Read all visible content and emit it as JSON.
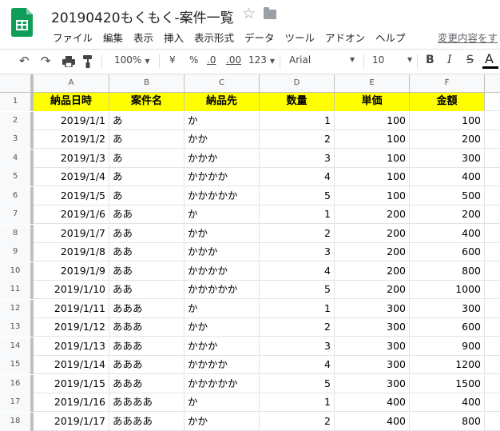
{
  "doc": {
    "title": "20190420もくもく-案件一覧",
    "star_icon": "star-outline-icon",
    "folder_icon": "folder-icon"
  },
  "menu": [
    "ファイル",
    "編集",
    "表示",
    "挿入",
    "表示形式",
    "データ",
    "ツール",
    "アドオン",
    "ヘルプ"
  ],
  "last_edit": "変更内容をす",
  "toolbar": {
    "zoom": "100%",
    "currency": "¥",
    "percent": "%",
    "dec_decrease": ".0",
    "dec_increase": ".00",
    "format": "123",
    "font": "Arial",
    "font_size": "10",
    "bold": "B",
    "italic": "I",
    "strike": "S",
    "text_color": "A"
  },
  "columns": [
    "A",
    "B",
    "C",
    "D",
    "E",
    "F"
  ],
  "header_fill": "#ffff00",
  "rows": [
    {
      "n": "1",
      "a": "納品日時",
      "b": "案件名",
      "c": "納品先",
      "d": "数量",
      "e": "単価",
      "f": "金額"
    },
    {
      "n": "2",
      "a": "2019/1/1",
      "b": "あ",
      "c": "か",
      "d": "1",
      "e": "100",
      "f": "100"
    },
    {
      "n": "3",
      "a": "2019/1/2",
      "b": "あ",
      "c": "かか",
      "d": "2",
      "e": "100",
      "f": "200"
    },
    {
      "n": "4",
      "a": "2019/1/3",
      "b": "あ",
      "c": "かかか",
      "d": "3",
      "e": "100",
      "f": "300"
    },
    {
      "n": "5",
      "a": "2019/1/4",
      "b": "あ",
      "c": "かかかか",
      "d": "4",
      "e": "100",
      "f": "400"
    },
    {
      "n": "6",
      "a": "2019/1/5",
      "b": "あ",
      "c": "かかかかか",
      "d": "5",
      "e": "100",
      "f": "500"
    },
    {
      "n": "7",
      "a": "2019/1/6",
      "b": "ああ",
      "c": "か",
      "d": "1",
      "e": "200",
      "f": "200"
    },
    {
      "n": "8",
      "a": "2019/1/7",
      "b": "ああ",
      "c": "かか",
      "d": "2",
      "e": "200",
      "f": "400"
    },
    {
      "n": "9",
      "a": "2019/1/8",
      "b": "ああ",
      "c": "かかか",
      "d": "3",
      "e": "200",
      "f": "600"
    },
    {
      "n": "10",
      "a": "2019/1/9",
      "b": "ああ",
      "c": "かかかか",
      "d": "4",
      "e": "200",
      "f": "800"
    },
    {
      "n": "11",
      "a": "2019/1/10",
      "b": "ああ",
      "c": "かかかかか",
      "d": "5",
      "e": "200",
      "f": "1000"
    },
    {
      "n": "12",
      "a": "2019/1/11",
      "b": "あああ",
      "c": "か",
      "d": "1",
      "e": "300",
      "f": "300"
    },
    {
      "n": "13",
      "a": "2019/1/12",
      "b": "あああ",
      "c": "かか",
      "d": "2",
      "e": "300",
      "f": "600"
    },
    {
      "n": "14",
      "a": "2019/1/13",
      "b": "あああ",
      "c": "かかか",
      "d": "3",
      "e": "300",
      "f": "900"
    },
    {
      "n": "15",
      "a": "2019/1/14",
      "b": "あああ",
      "c": "かかかか",
      "d": "4",
      "e": "300",
      "f": "1200"
    },
    {
      "n": "16",
      "a": "2019/1/15",
      "b": "あああ",
      "c": "かかかかか",
      "d": "5",
      "e": "300",
      "f": "1500"
    },
    {
      "n": "17",
      "a": "2019/1/16",
      "b": "ああああ",
      "c": "か",
      "d": "1",
      "e": "400",
      "f": "400"
    },
    {
      "n": "18",
      "a": "2019/1/17",
      "b": "ああああ",
      "c": "かか",
      "d": "2",
      "e": "400",
      "f": "800"
    }
  ]
}
